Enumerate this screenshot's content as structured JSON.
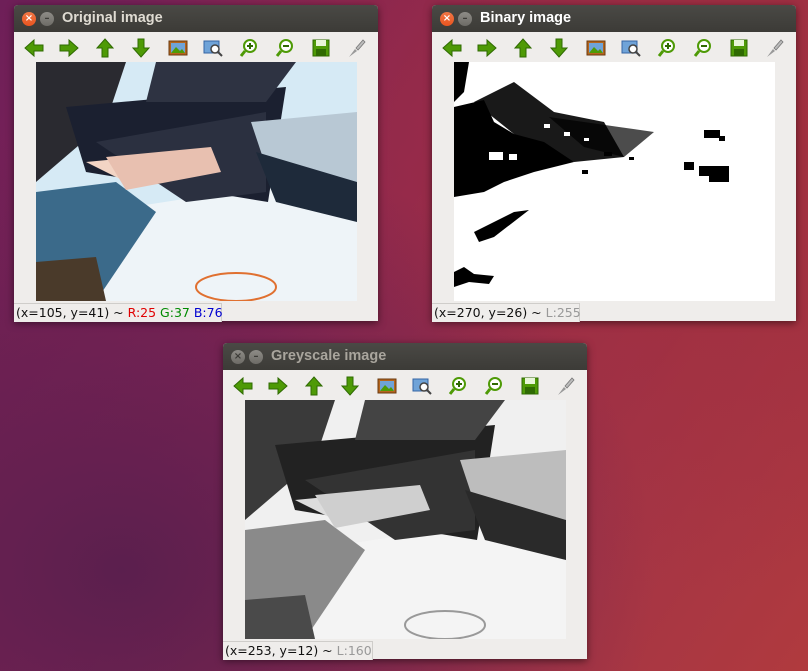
{
  "windows": {
    "original": {
      "title": "Original image",
      "status": {
        "coords": "(x=105, y=41) ~ ",
        "r": "R:25",
        "g": "G:37",
        "b": "B:76"
      }
    },
    "binary": {
      "title": "Binary image",
      "status": {
        "coords": "(x=270, y=26) ~ ",
        "l": "L:255"
      }
    },
    "greyscale": {
      "title": "Greyscale image",
      "status": {
        "coords": "(x=253, y=12) ~ ",
        "l": "L:160"
      }
    }
  },
  "titlebar_icons": {
    "close": "close-icon",
    "minimize": "minimize-icon"
  },
  "toolbar_icons": [
    "arrow-left-icon",
    "arrow-right-icon",
    "arrow-up-icon",
    "arrow-down-icon",
    "image-icon",
    "zoom-fit-icon",
    "zoom-in-icon",
    "zoom-out-icon",
    "save-icon",
    "properties-icon"
  ],
  "colors": {
    "toolbar_green": "#4e9a06",
    "close_red": "#e9541f"
  }
}
